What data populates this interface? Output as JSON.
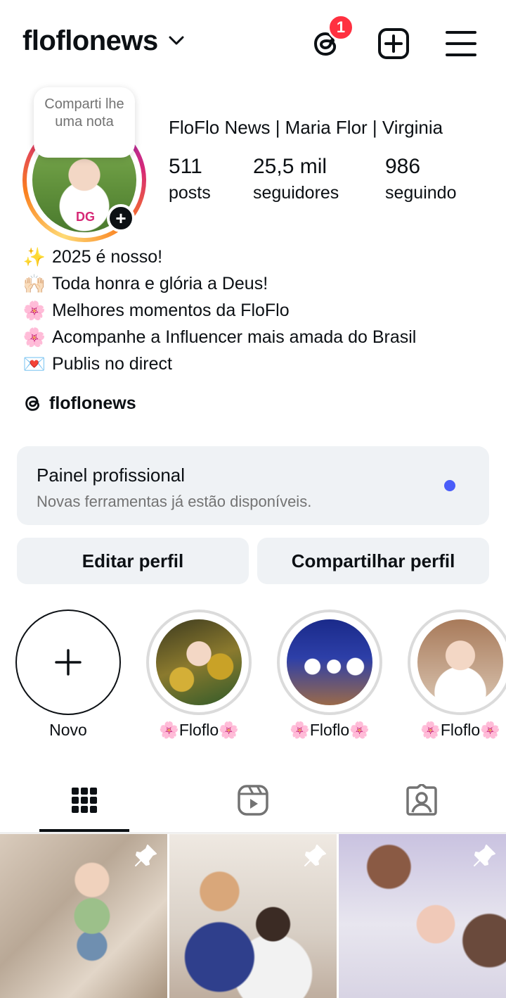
{
  "header": {
    "username": "floflonews",
    "threads_badge": "1",
    "icons": {
      "threads": "threads-icon",
      "new_post": "plus-square-icon",
      "menu": "hamburger-menu-icon",
      "chevron": "chevron-down-icon"
    }
  },
  "profile": {
    "note_text": "Comparti lhe uma nota",
    "full_name": "FloFlo News | Maria Flor | Virginia",
    "avatar_shirt_logo": "DG",
    "stats": [
      {
        "value": "511",
        "label": "posts"
      },
      {
        "value": "25,5 mil",
        "label": "seguidores"
      },
      {
        "value": "986",
        "label": "seguindo"
      }
    ]
  },
  "bio": {
    "lines": [
      {
        "emoji": "✨",
        "text": "2025 é nosso!"
      },
      {
        "emoji": "🙌🏻",
        "text": "Toda honra e glória a Deus!"
      },
      {
        "emoji": "🌸",
        "text": "Melhores momentos da FloFlo"
      },
      {
        "emoji": "🌸",
        "text": "Acompanhe a Influencer mais amada do Brasil"
      },
      {
        "emoji": "💌",
        "text": "Publis no direct"
      }
    ],
    "threads_handle": "floflonews"
  },
  "pro_panel": {
    "title": "Painel profissional",
    "subtitle": "Novas ferramentas já estão disponíveis."
  },
  "buttons": {
    "edit": "Editar perfil",
    "share": "Compartilhar perfil"
  },
  "highlights": [
    {
      "label": "Novo"
    },
    {
      "label": "🌸Floflo🌸"
    },
    {
      "label": "🌸Floflo🌸"
    },
    {
      "label": "🌸Floflo🌸"
    }
  ],
  "tabs": {
    "active": "grid",
    "icons": [
      "grid-icon",
      "reels-icon",
      "tagged-icon"
    ]
  },
  "colors": {
    "accent_blue": "#4a5df9",
    "badge_red": "#ff3040",
    "panel_bg": "#eff2f5"
  }
}
